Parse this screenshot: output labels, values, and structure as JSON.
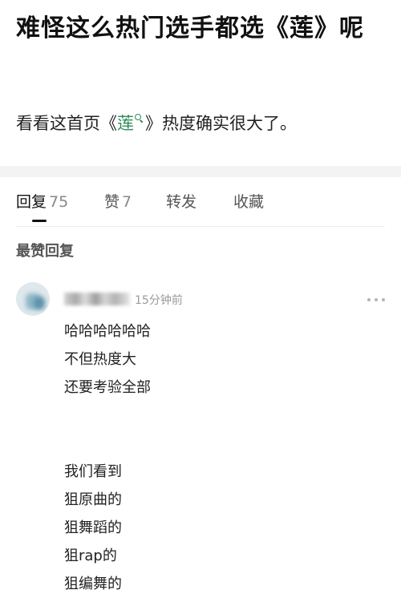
{
  "post": {
    "title": "难怪这么热门选手都选《莲》呢",
    "body_before": "看看这首页《",
    "body_link": "莲",
    "body_after": "》热度确实很大了。",
    "link_color": "#2e8b57"
  },
  "tabs": [
    {
      "label": "回复",
      "count": "75",
      "active": true
    },
    {
      "label": "赞",
      "count": "7",
      "active": false
    },
    {
      "label": "转发",
      "count": "",
      "active": false
    },
    {
      "label": "收藏",
      "count": "",
      "active": false
    }
  ],
  "section_heading": "最赞回复",
  "comment": {
    "time": "15分钟前",
    "lines": [
      "哈哈哈哈哈哈",
      "不但热度大",
      "还要考验全部",
      "",
      "",
      "我们看到",
      "狙原曲的",
      "狙舞蹈的",
      "狙rap的",
      "狙编舞的"
    ]
  },
  "icons": {
    "search": "search-icon",
    "more": "more-options-icon"
  }
}
